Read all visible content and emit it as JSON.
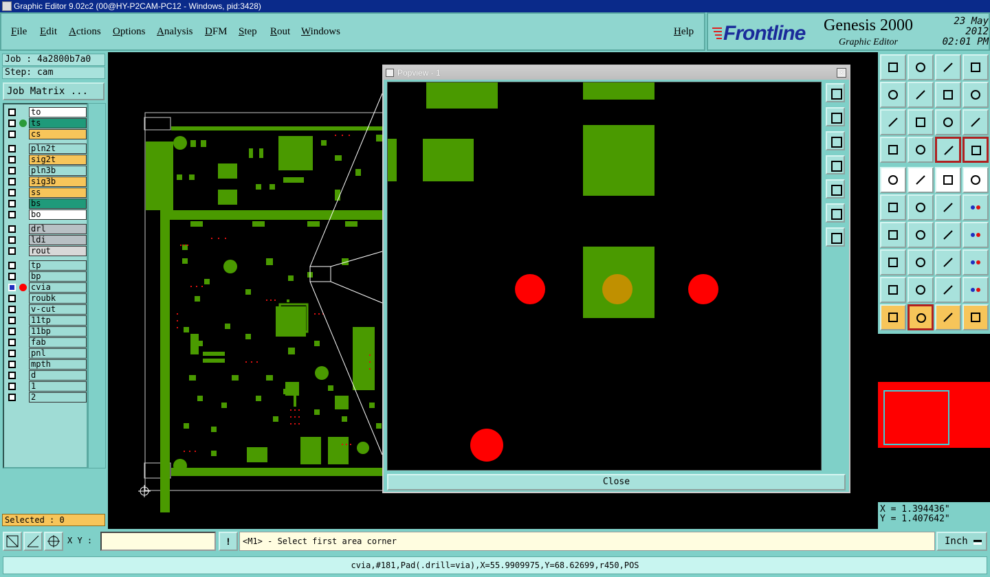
{
  "window": {
    "title": "Graphic Editor 9.02c2 (00@HY-P2CAM-PC12 - Windows, pid:3428)"
  },
  "menu": {
    "items": [
      "File",
      "Edit",
      "Actions",
      "Options",
      "Analysis",
      "DFM",
      "Step",
      "Rout",
      "Windows"
    ],
    "help": "Help"
  },
  "brand": {
    "company": "Frontline",
    "product": "Genesis 2000",
    "module": "Graphic Editor",
    "date": "23 May 2012",
    "time": "02:01 PM"
  },
  "job": {
    "job_label": "Job : 4a2800b7a0",
    "step_label": "Step: cam",
    "matrix_button": "Job Matrix ..."
  },
  "layers": [
    {
      "name": "to",
      "color": "#ffffff"
    },
    {
      "name": "ts",
      "color": "#1f9a7a",
      "dot": "#2a9a3a"
    },
    {
      "name": "cs",
      "color": "#f7c55a"
    },
    {
      "name": "pln2t",
      "color": "#9fdcd5"
    },
    {
      "name": "sig2t",
      "color": "#f7c55a"
    },
    {
      "name": "pln3b",
      "color": "#9fdcd5"
    },
    {
      "name": "sig3b",
      "color": "#f7c55a"
    },
    {
      "name": "ss",
      "color": "#f7c55a"
    },
    {
      "name": "bs",
      "color": "#1f9a7a"
    },
    {
      "name": "bo",
      "color": "#ffffff"
    },
    {
      "name": "drl",
      "color": "#b8c0c4"
    },
    {
      "name": "ldi",
      "color": "#b8c0c4"
    },
    {
      "name": "rout",
      "color": "#d8d8d8"
    },
    {
      "name": "tp",
      "color": "#9fdcd5"
    },
    {
      "name": "bp",
      "color": "#9fdcd5"
    },
    {
      "name": "cvia",
      "color": "#9fdcd5",
      "dot": "#ff0000",
      "active": true
    },
    {
      "name": "roubk",
      "color": "#9fdcd5"
    },
    {
      "name": "v-cut",
      "color": "#9fdcd5"
    },
    {
      "name": "11tp",
      "color": "#9fdcd5"
    },
    {
      "name": "11bp",
      "color": "#9fdcd5"
    },
    {
      "name": "fab",
      "color": "#9fdcd5"
    },
    {
      "name": "pnl",
      "color": "#9fdcd5"
    },
    {
      "name": "mpth",
      "color": "#9fdcd5"
    },
    {
      "name": "d",
      "color": "#9fdcd5"
    },
    {
      "name": "1",
      "color": "#9fdcd5"
    },
    {
      "name": "2",
      "color": "#9fdcd5"
    }
  ],
  "selected": "Selected : 0",
  "popview": {
    "title": "Popview - 1",
    "close_label": "Close"
  },
  "coords": {
    "x": "X = 1.394436\"",
    "y": "Y = 1.407642\""
  },
  "command": {
    "xy_label": "X Y :",
    "xy_value": "",
    "prompt": "<M1> - Select first area corner",
    "units": "Inch"
  },
  "status": "cvia,#181,Pad(.drill=via),X=55.9909975,Y=68.62699,r450,POS",
  "colors": {
    "panel": "#7fd0c8",
    "copper": "#4a9a00",
    "via": "#ff0000",
    "overlap": "#c09000"
  }
}
